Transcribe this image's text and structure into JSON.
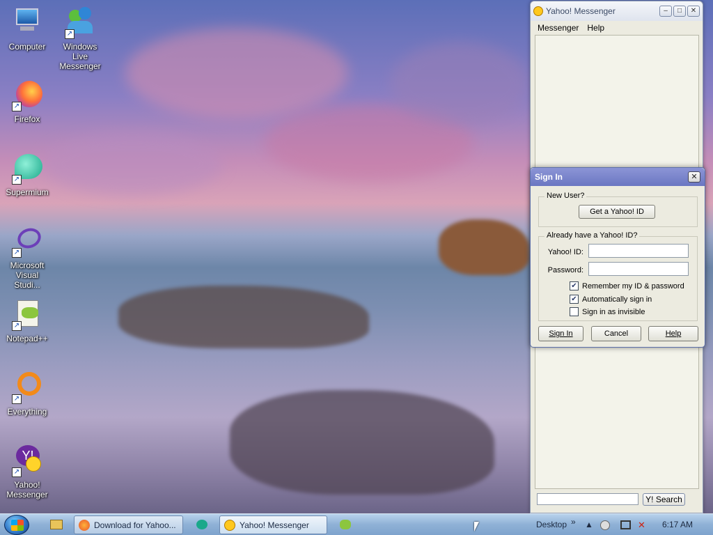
{
  "desktop": {
    "icons": [
      {
        "label": "Computer"
      },
      {
        "label": "Windows Live Messenger"
      },
      {
        "label": "Firefox"
      },
      {
        "label": "Supermium"
      },
      {
        "label": "Microsoft Visual Studi..."
      },
      {
        "label": "Notepad++"
      },
      {
        "label": "Everything"
      },
      {
        "label": "Yahoo! Messenger"
      }
    ]
  },
  "messenger": {
    "title": "Yahoo! Messenger",
    "menu": [
      "Messenger",
      "Help"
    ],
    "search_button": "Y! Search",
    "search_value": ""
  },
  "signin": {
    "title": "Sign In",
    "new_user_label": "New User?",
    "get_id_button": "Get a Yahoo! ID",
    "have_id_label": "Already have a Yahoo! ID?",
    "id_label": "Yahoo! ID:",
    "id_value": "",
    "password_label": "Password:",
    "password_value": "",
    "remember_label": "Remember my ID & password",
    "remember_checked": true,
    "auto_label": "Automatically sign in",
    "auto_checked": true,
    "invisible_label": "Sign in as invisible",
    "invisible_checked": false,
    "signin_button": "Sign In",
    "cancel_button": "Cancel",
    "help_button": "Help"
  },
  "taskbar": {
    "items": [
      {
        "label": "Download for Yahoo..."
      },
      {
        "label": "Yahoo! Messenger"
      }
    ],
    "toolbar_label": "Desktop",
    "clock": "6:17 AM"
  },
  "colors": {
    "dialog_title": "#6a76c2",
    "taskbar": "#8fb1d6"
  }
}
